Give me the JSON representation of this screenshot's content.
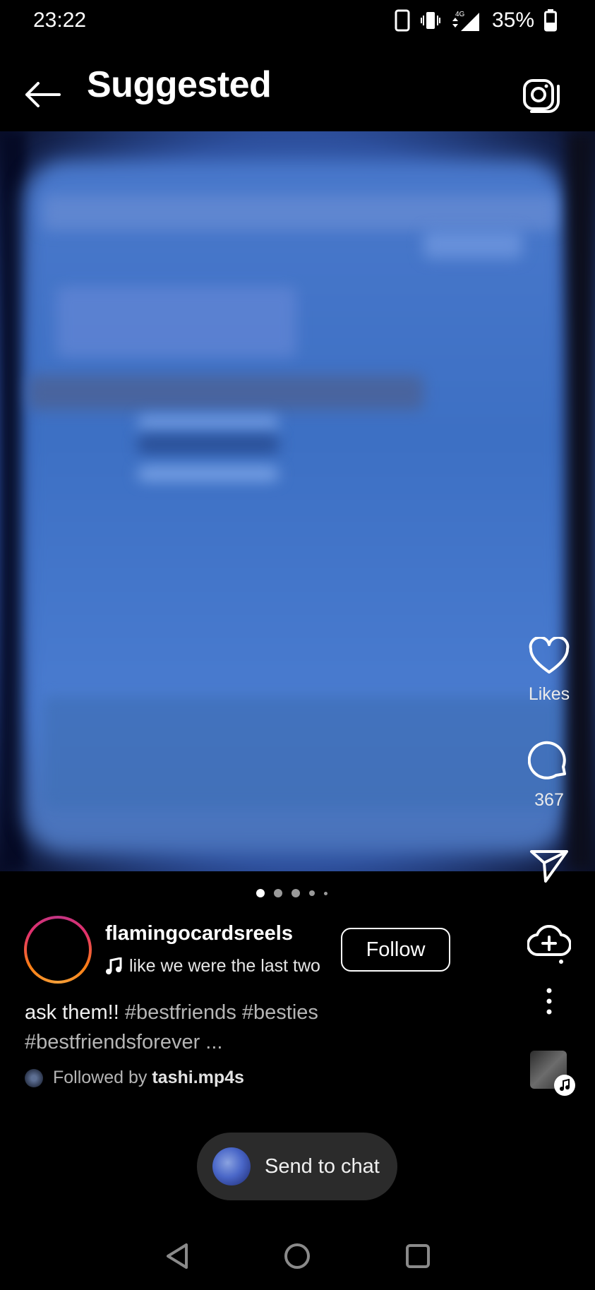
{
  "status_bar": {
    "time": "23:22",
    "network": "4G",
    "battery": "35%",
    "icons": [
      "portrait-lock-icon",
      "vibrate-icon",
      "signal-icon",
      "battery-icon"
    ]
  },
  "header": {
    "title": "Suggested",
    "back_icon": "arrow-left-icon",
    "camera_icon": "camera-icon"
  },
  "carousel": {
    "total_dots": 5,
    "active_index": 0
  },
  "actions": {
    "like_label": "Likes",
    "comment_count": "367",
    "share_icon": "send-icon",
    "remix_icon": "remix-icon",
    "more_icon": "more-vertical-icon"
  },
  "post": {
    "username": "flamingocardsreels",
    "audio_title": "like we were the last two",
    "follow_label": "Follow",
    "caption_text": "ask them!! ",
    "caption_tags": "#bestfriends #besties #bestfriendsforever ...",
    "followed_by_prefix": "Followed by ",
    "followed_by_user": "tashi.mp4s"
  },
  "send_to_chat": {
    "label": "Send to chat"
  },
  "nav": {
    "back_icon": "nav-back-icon",
    "home_icon": "nav-home-icon",
    "recents_icon": "nav-recents-icon"
  },
  "colors": {
    "background": "#000000",
    "media_blue": "#3d70c4",
    "pill_bg": "#2b2b2b"
  }
}
